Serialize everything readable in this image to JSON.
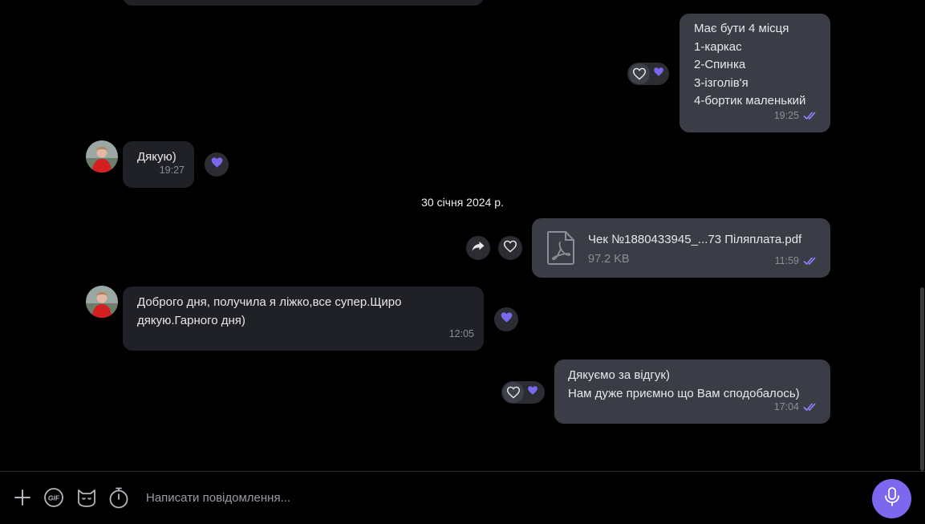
{
  "colors": {
    "background": "#000000",
    "incoming_bubble": "#1f2126",
    "outgoing_bubble": "#3a3d45",
    "accent": "#7b68ee",
    "read_ticks": "#8f85ff"
  },
  "messages": [
    {
      "id": "m1",
      "direction": "outgoing",
      "lines": [
        "Має бути 4 місця",
        "1-каркас",
        "2-Спинка",
        "3-ізголів'я",
        "4-бортик маленький"
      ],
      "time": "19:25",
      "status": "read",
      "reactions": [
        "heart-outline-icon",
        "purple-heart-icon"
      ]
    },
    {
      "id": "m2",
      "direction": "incoming",
      "lines": [
        "Дякую)"
      ],
      "time": "19:27",
      "reactions": [
        "purple-heart-icon"
      ]
    },
    {
      "id": "m3",
      "direction": "outgoing",
      "type": "file",
      "file_name": "Чек №1880433945_...73 Піляплата.pdf",
      "file_size": "97.2 KB",
      "time": "11:59",
      "status": "read"
    },
    {
      "id": "m4",
      "direction": "incoming",
      "lines": [
        "Доброго дня, получила я ліжко,все супер.Щиро",
        "дякую.Гарного дня)"
      ],
      "time": "12:05",
      "reactions": [
        "purple-heart-icon"
      ]
    },
    {
      "id": "m5",
      "direction": "outgoing",
      "lines": [
        "Дякуємо за відгук)",
        "Нам дуже приємно що Вам сподобалось)"
      ],
      "time": "17:04",
      "status": "read",
      "reactions": [
        "heart-outline-icon",
        "purple-heart-icon"
      ]
    }
  ],
  "date_separator": "30 січня 2024 р.",
  "composer": {
    "placeholder": "Написати повідомлення...",
    "gif_label": "GIF",
    "icons": [
      "plus-icon",
      "gif-icon",
      "sticker-icon",
      "timer-icon",
      "microphone-icon"
    ]
  }
}
